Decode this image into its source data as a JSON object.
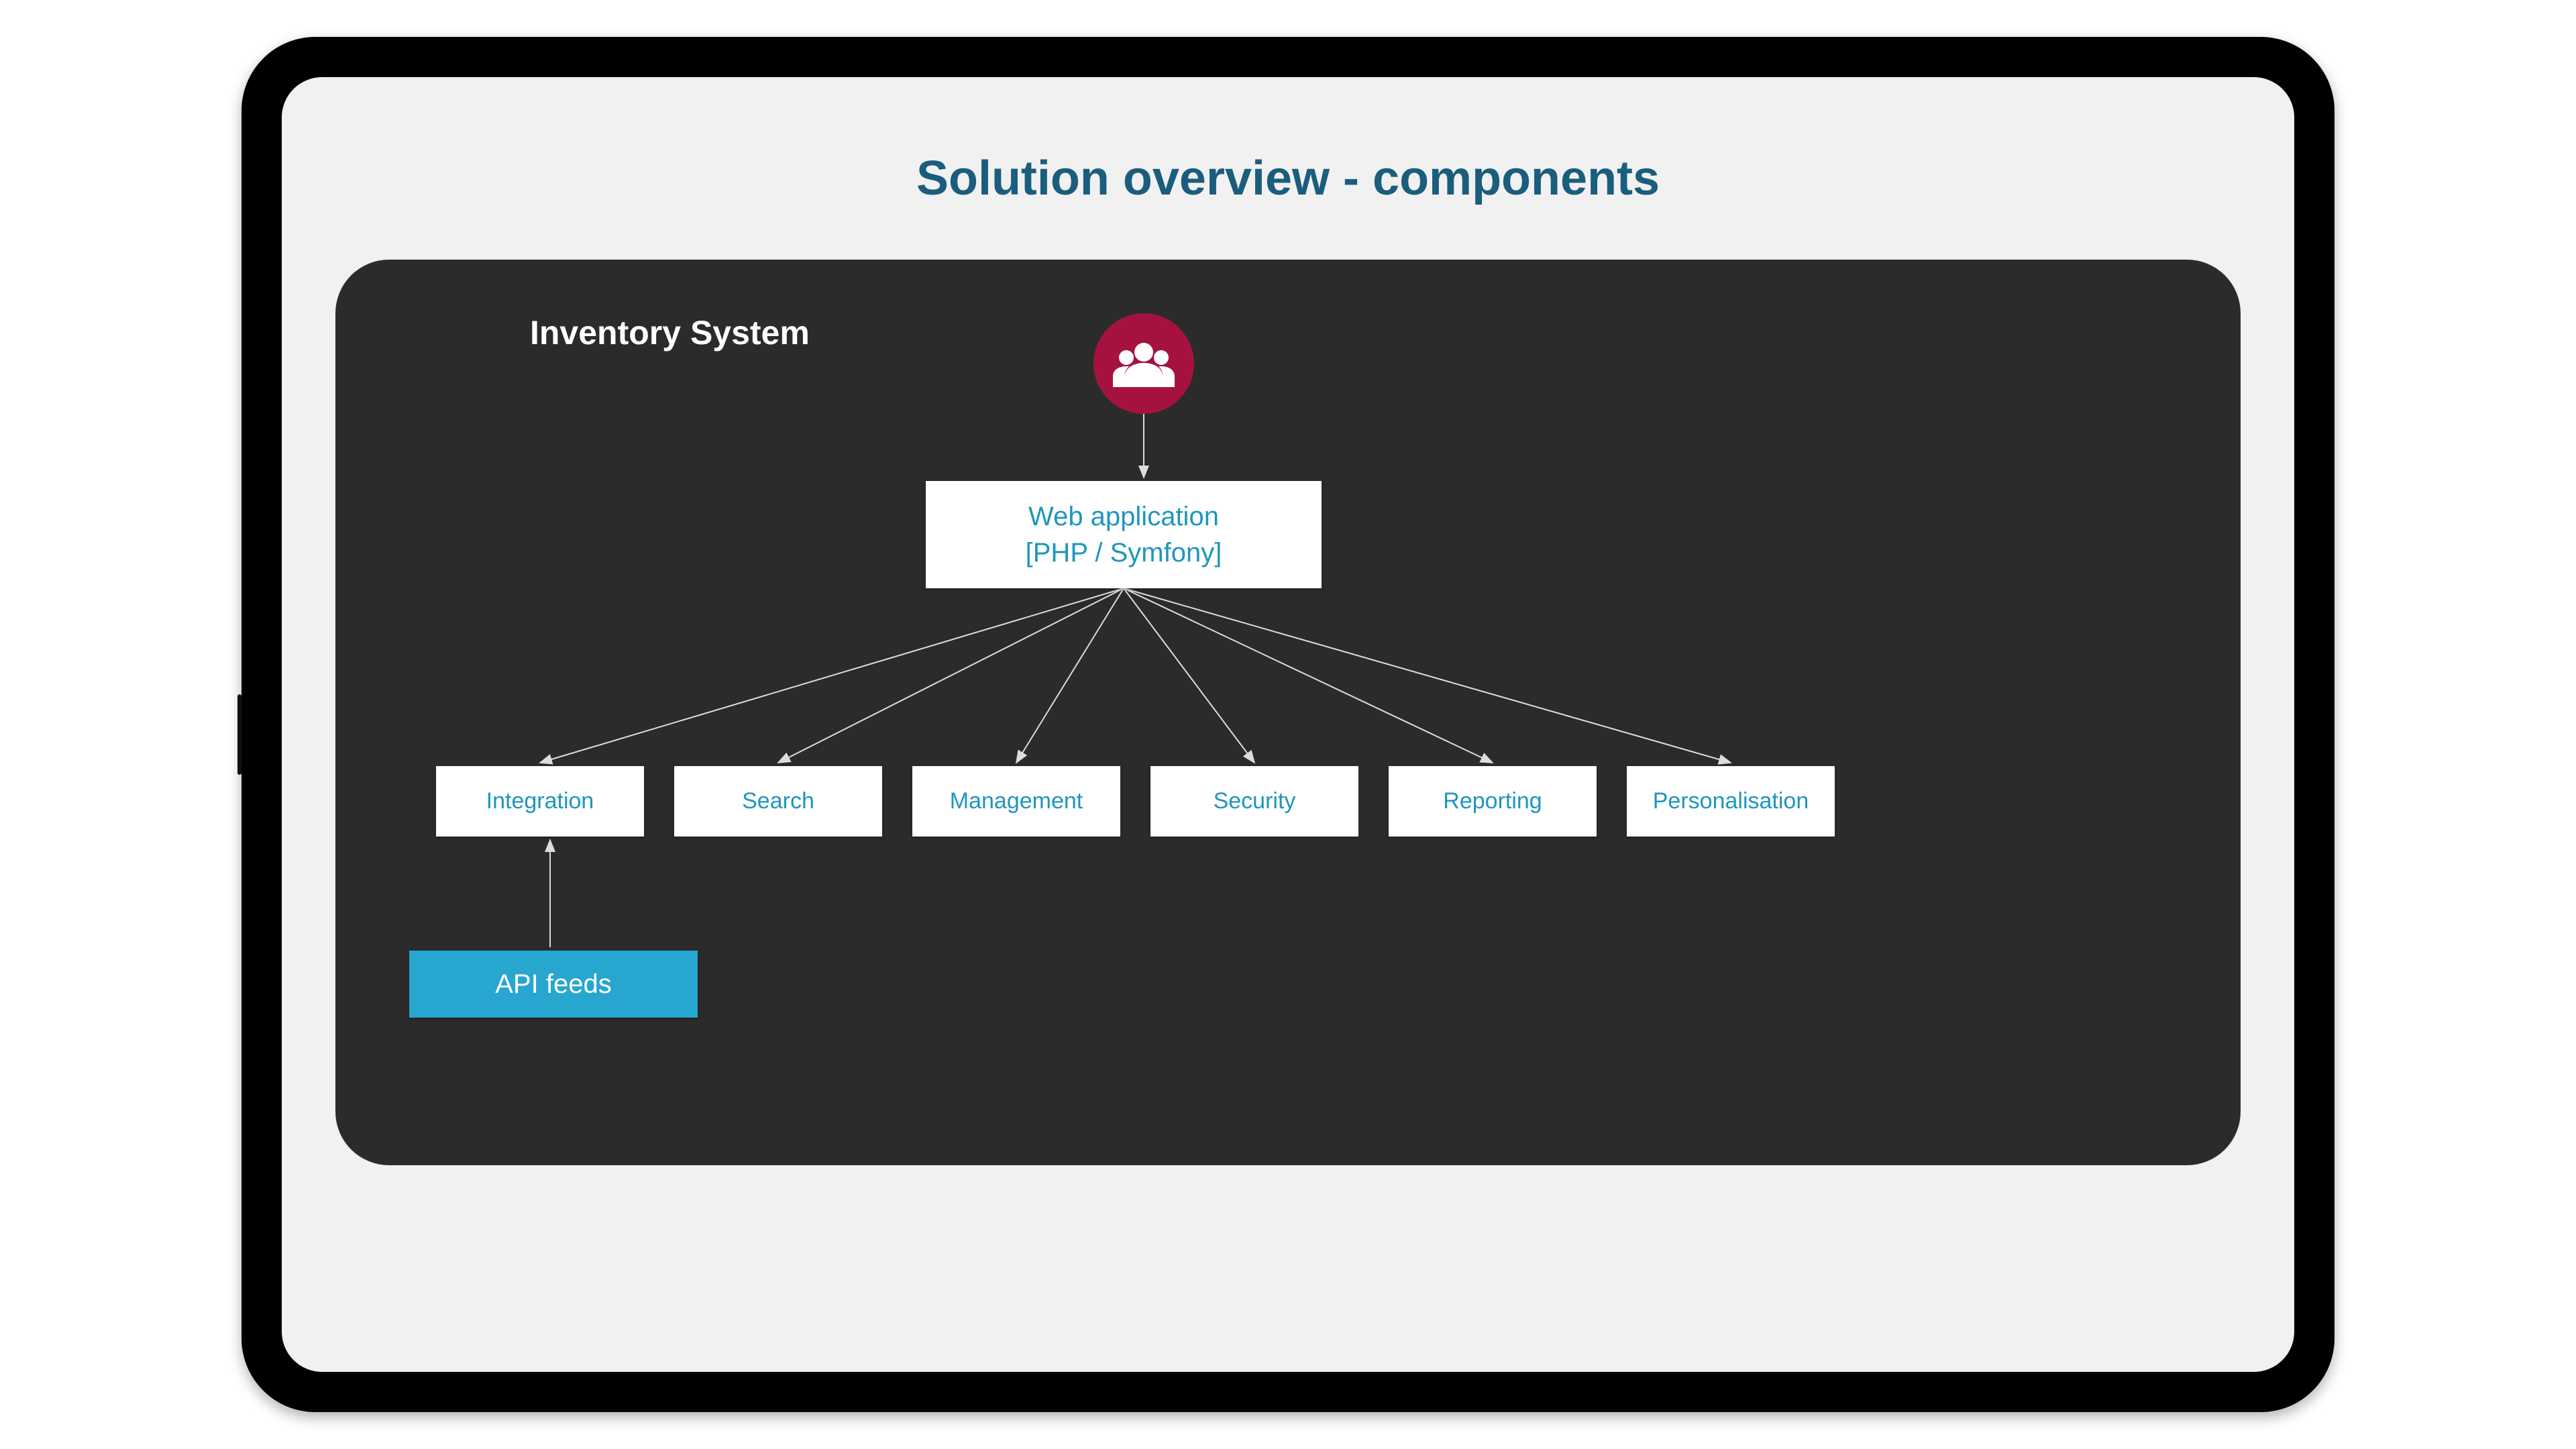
{
  "title": "Solution overview - components",
  "panel_heading": "Inventory System",
  "icons": {
    "users": "users-icon"
  },
  "webapp": {
    "line1": "Web application",
    "line2": "[PHP / Symfony]"
  },
  "modules": [
    "Integration",
    "Search",
    "Management",
    "Security",
    "Reporting",
    "Personalisation"
  ],
  "api_feeds_label": "API feeds",
  "colors": {
    "title": "#1b5d7c",
    "panel_bg": "#2b2b2b",
    "box_text": "#1f96bd",
    "users_circle": "#a6123f",
    "api_box": "#27a6d0"
  }
}
